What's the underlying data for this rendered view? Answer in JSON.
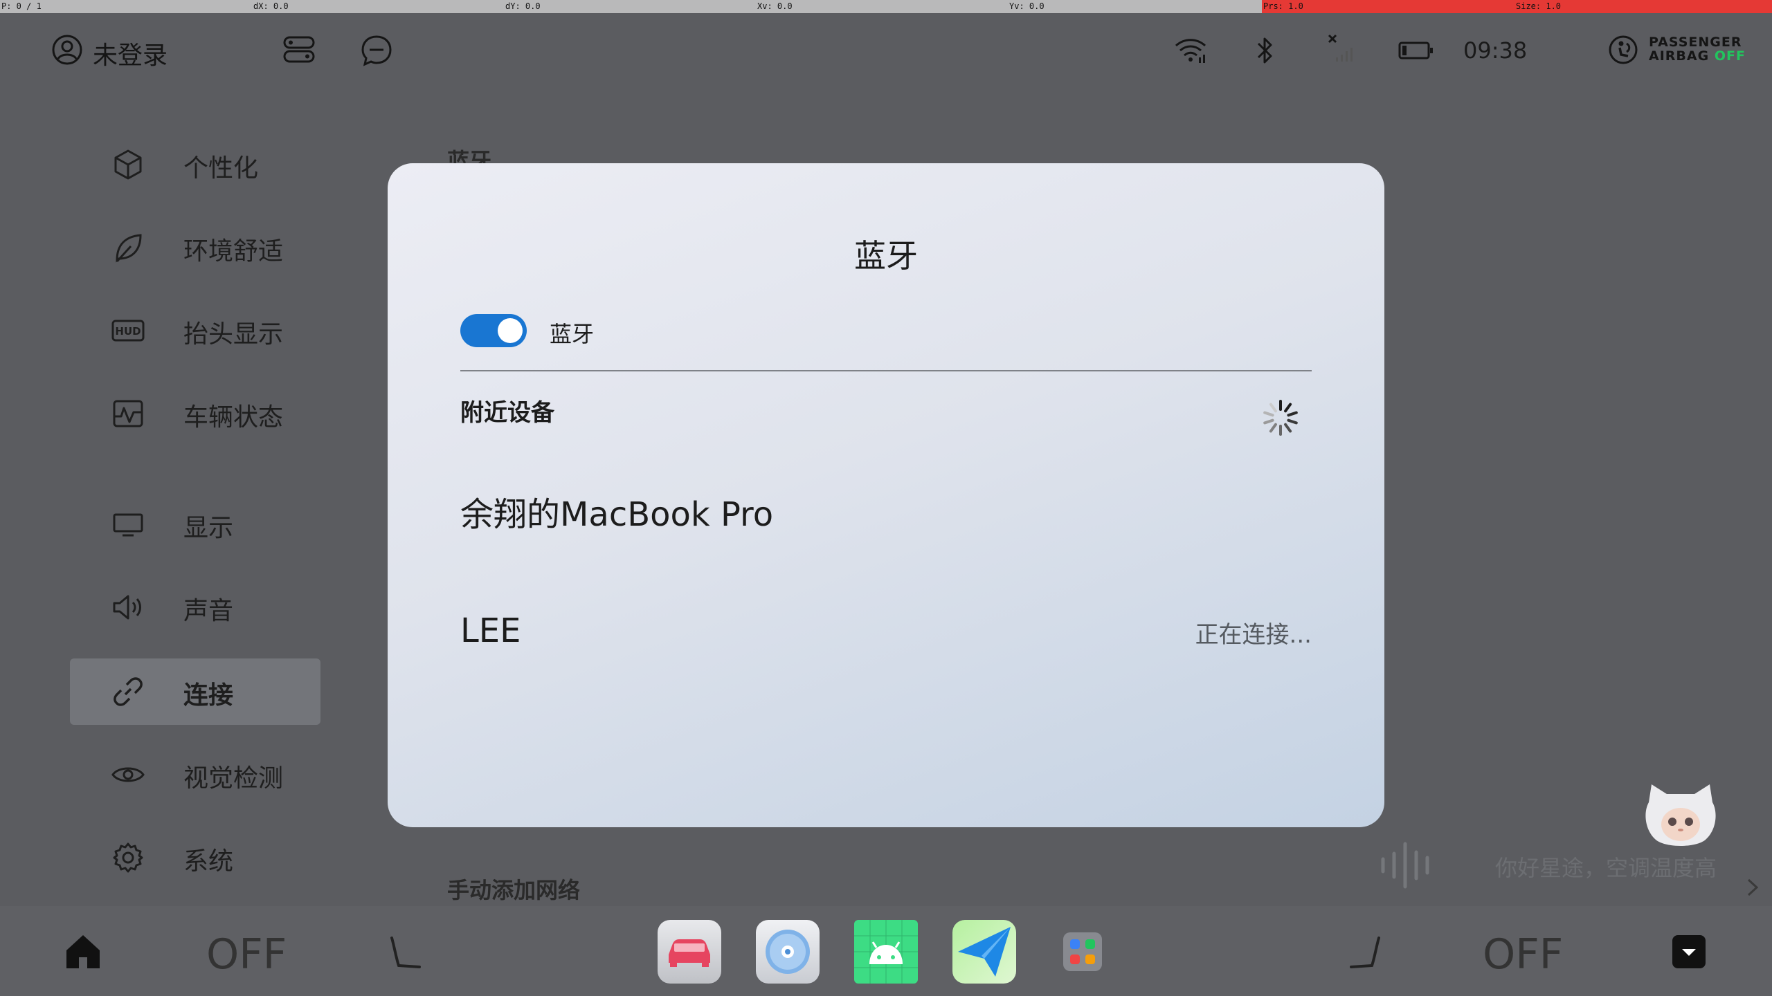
{
  "debug": {
    "p": "P: 0 / 1",
    "dx": "dX: 0.0",
    "dy": "dY: 0.0",
    "xv": "Xv: 0.0",
    "yv": "Yv: 0.0",
    "prs": "Prs: 1.0",
    "size": "Size: 1.0",
    "accent": "#e53935"
  },
  "status_bar": {
    "user_label": "未登录",
    "icons": [
      "user-circle-icon",
      "toggle-list-icon",
      "chat-bubble-icon",
      "wifi-icon",
      "bluetooth-icon",
      "no-signal-icon",
      "battery-icon",
      "airbag-icon"
    ],
    "clock": "09:38",
    "airbag_line1": "PASSENGER",
    "airbag_line2": "AIRBAG",
    "airbag_state": "OFF",
    "airbag_state_color": "#22c55e"
  },
  "sidebar": {
    "items": [
      {
        "label": "个性化",
        "icon": "cube-icon"
      },
      {
        "label": "环境舒适",
        "icon": "leaf-icon"
      },
      {
        "label": "抬头显示",
        "icon": "hud-icon"
      },
      {
        "label": "车辆状态",
        "icon": "vehicle-status-icon"
      },
      {
        "label": "显示",
        "icon": "monitor-icon"
      },
      {
        "label": "声音",
        "icon": "speaker-icon"
      },
      {
        "label": "连接",
        "icon": "link-icon",
        "active": true
      },
      {
        "label": "视觉检测",
        "icon": "eye-icon"
      },
      {
        "label": "系统",
        "icon": "gear-icon"
      }
    ]
  },
  "background": {
    "section_title": "蓝牙",
    "manual_add": "手动添加网络"
  },
  "dialog": {
    "title": "蓝牙",
    "toggle_label": "蓝牙",
    "toggle_on": true,
    "toggle_color": "#1976d2",
    "nearby_label": "附近设备",
    "devices": [
      {
        "name": "余翔的MacBook Pro",
        "status": ""
      },
      {
        "name": "LEE",
        "status": "正在连接..."
      }
    ]
  },
  "assistant": {
    "text": "你好星途，空调温度高"
  },
  "dock": {
    "left_fan": "OFF",
    "right_fan": "OFF",
    "apps": [
      "car-app-icon",
      "music-disc-app-icon",
      "android-app-icon",
      "navigation-app-icon",
      "app-grid-icon"
    ]
  }
}
